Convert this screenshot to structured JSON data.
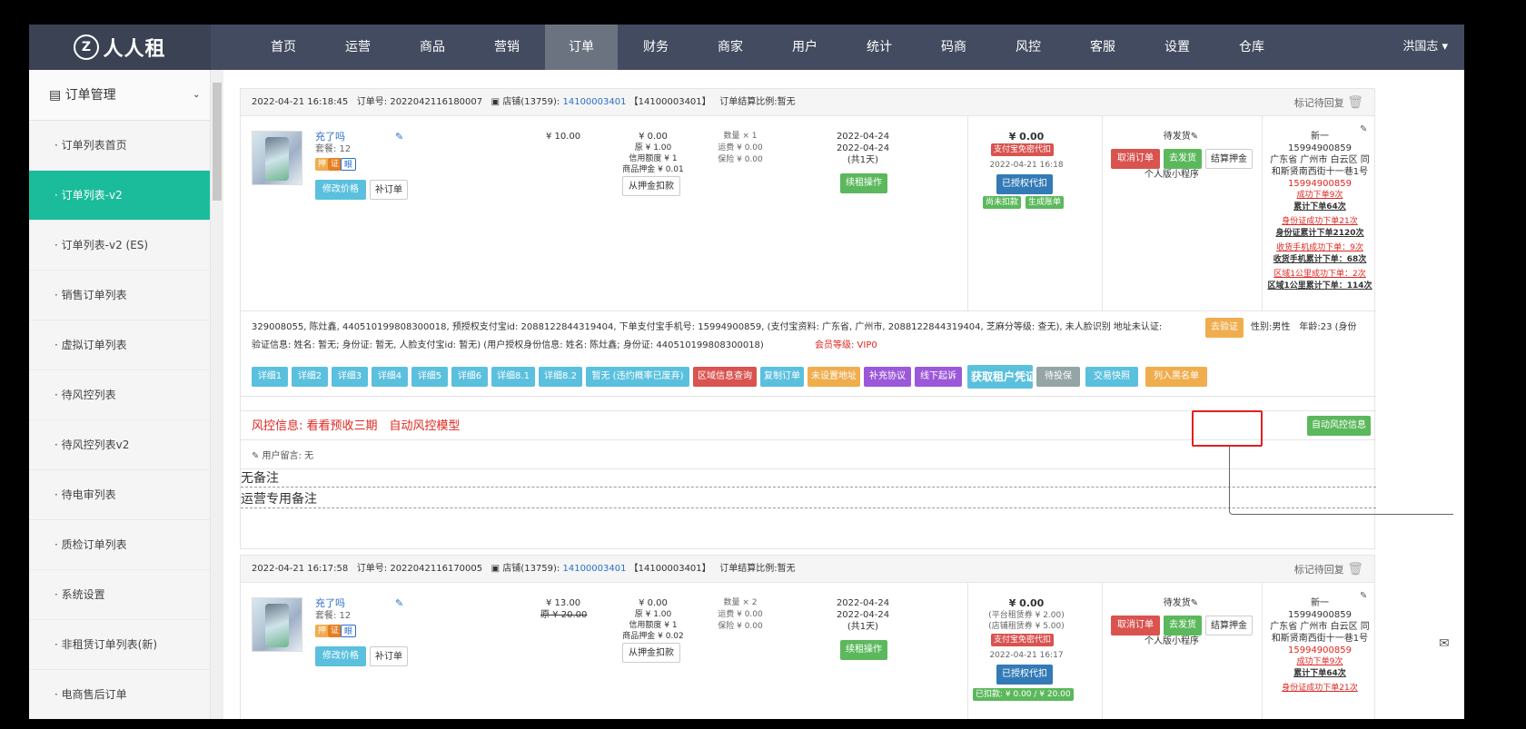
{
  "app": {
    "logo_text": "人人租",
    "logo_mark": "Z"
  },
  "nav": {
    "items": [
      "首页",
      "运营",
      "商品",
      "营销",
      "订单",
      "财务",
      "商家",
      "用户",
      "统计",
      "码商",
      "风控",
      "客服",
      "设置",
      "仓库"
    ],
    "active": "订单",
    "user": "洪国志 ▾"
  },
  "sidebar": {
    "header": "订单管理",
    "items": [
      "订单列表首页",
      "订单列表-v2",
      "订单列表-v2 (ES)",
      "销售订单列表",
      "虚拟订单列表",
      "待风控列表",
      "待风控列表v2",
      "待电审列表",
      "质检订单列表",
      "系统设置",
      "非租赁订单列表(新)",
      "电商售后订单"
    ],
    "active_index": 1
  },
  "order1": {
    "header": {
      "datetime": "2022-04-21 16:18:45",
      "order_no_label": "订单号:",
      "order_no": "2022042116180007",
      "shop_label": "店铺(13759):",
      "shop_id": "14100003401",
      "shop_bracket": "【14100003401】",
      "settle_ratio": "订单结算比例:暂无",
      "mark_reply": "标记待回复"
    },
    "product": {
      "name": "充了吗",
      "package": "套餐: 12",
      "edit_price": "修改价格",
      "reorder": "补订单"
    },
    "rent": "¥ 10.00",
    "amounts": [
      "¥ 0.00",
      "原 ¥ 1.00",
      "信用额度 ¥ 1",
      "商品押金 ¥ 0.01"
    ],
    "deduct_deposit": "从押金扣款",
    "qty": [
      "数量 × 1",
      "运费 ¥ 0.00",
      "保险 ¥ 0.00"
    ],
    "dates": [
      "2022-04-24",
      "2022-04-24",
      "(共1天)"
    ],
    "renew_btn": "续租操作",
    "pay": {
      "amount": "¥ 0.00",
      "tag": "支付宝免密代扣",
      "time": "2022-04-21 16:18",
      "auth_btn": "已授权代扣",
      "tag2": "尚未扣款",
      "tag3": "生成账单"
    },
    "ship": {
      "status": "待发货",
      "cancel": "取消订单",
      "ship": "去发货",
      "settle": "结算押金",
      "source": "个人版小程序"
    },
    "user": {
      "lines": [
        "新一",
        "15994900859",
        "广东省 广州市 白云区 同",
        "和斯贤南西街十一巷1号"
      ],
      "phone_red": "15994900859",
      "stats": [
        "成功下单9次",
        "累计下单64次",
        "身份证成功下单21次",
        "身份证累计下单2120次",
        "收货手机成功下单：9次",
        "收货手机累计下单：68次",
        "区域1公里成功下单：2次",
        "区域1公里累计下单：114次"
      ]
    },
    "info_line1": "329008055, 陈灶鑫, 440510199808300018, 预授权支付宝id: 2088122844319404, 下单支付宝手机号: 15994900859, (支付宝资料: 广东省, 广州市, 2088122844319404, 芝麻分等级: 查无), 未人脸识别 地址未认证:",
    "verify_btn": "去验证",
    "info_gender": "性别:男性　年龄:23 (身份",
    "info_line2": "验证信息: 姓名: 暂无; 身份证: 暂无, 人脸支付宝id: 暂无) (用户授权身份信息: 姓名: 陈灶鑫; 身份证: 440510199808300018)",
    "member_level": "会员等级: VIP0",
    "actions": [
      "详细1",
      "详细2",
      "详细3",
      "详细4",
      "详细5",
      "详细6",
      "详细8.1",
      "详细8.2",
      "暂无 (违约概率已废弃)",
      "区域信息查询",
      "复制订单",
      "未设置地址",
      "补充协议",
      "线下起诉",
      "获取租户凭证",
      "待投保",
      "交易快照",
      "列入黑名单"
    ],
    "risk_info": "风控信息: 看看预收三期　自动风控模型",
    "auto_risk_btn": "自动风控信息",
    "user_msg": "✎ 用户留言: 无",
    "note1": "无备注",
    "note2": "运营专用备注"
  },
  "order2": {
    "header": {
      "datetime": "2022-04-21 16:17:58",
      "order_no_label": "订单号:",
      "order_no": "2022042116170005",
      "shop_label": "店铺(13759):",
      "shop_id": "14100003401",
      "shop_bracket": "【14100003401】",
      "settle_ratio": "订单结算比例:暂无",
      "mark_reply": "标记待回复"
    },
    "product": {
      "name": "充了吗",
      "package": "套餐: 12",
      "edit_price": "修改价格",
      "reorder": "补订单"
    },
    "rent": "¥ 13.00",
    "rent_orig": "原 ¥ 20.00",
    "amounts": [
      "¥ 0.00",
      "原 ¥ 1.00",
      "信用额度 ¥ 1",
      "商品押金 ¥ 0.02"
    ],
    "deduct_deposit": "从押金扣款",
    "qty": [
      "数量 × 2",
      "运费 ¥ 0.00",
      "保险 ¥ 0.00"
    ],
    "dates": [
      "2022-04-24",
      "2022-04-24",
      "(共1天)"
    ],
    "renew_btn": "续租操作",
    "pay": {
      "amount": "¥ 0.00",
      "fee1": "(平台租赁券 ¥ 2.00)",
      "fee2": "(店铺租赁券 ¥ 5.00)",
      "tag": "支付宝免密代扣",
      "time": "2022-04-21 16:17",
      "auth_btn": "已授权代扣",
      "tag2": "已扣款: ¥ 0.00 / ¥ 20.00"
    },
    "ship": {
      "status": "待发货",
      "cancel": "取消订单",
      "ship": "去发货",
      "settle": "结算押金",
      "source": "个人版小程序"
    },
    "user": {
      "lines": [
        "新一",
        "15994900859",
        "广东省 广州市 白云区 同",
        "和斯贤南西街十一巷1号"
      ],
      "phone_red": "15994900859",
      "stats": [
        "成功下单9次",
        "累计下单64次",
        "身份证成功下单21次"
      ]
    }
  },
  "colors": {
    "nav_bg": "#424b5f",
    "active_sidebar": "#1bbc9b",
    "highlight": "#e02020"
  }
}
